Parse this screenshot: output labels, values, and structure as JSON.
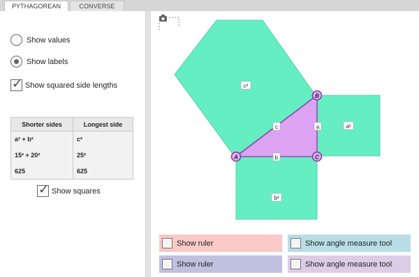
{
  "tabs": [
    {
      "label": "PYTHAGOREAN"
    },
    {
      "label": "CONVERSE"
    }
  ],
  "options": {
    "show_values": "Show values",
    "show_labels": "Show labels",
    "show_squared": "Show squared side lengths",
    "show_squares": "Show squares"
  },
  "table": {
    "headers": [
      "Shorter sides",
      "Longest side"
    ],
    "rows": [
      {
        "left": "a² + b²",
        "right": "c²"
      },
      {
        "left": "15² + 20²",
        "right": "25²"
      },
      {
        "left": "625",
        "right": "625"
      }
    ]
  },
  "geometry_labels": {
    "vertex_a": "A",
    "vertex_b": "B",
    "vertex_c": "C",
    "side_a": "a",
    "side_b": "b",
    "side_c": "c",
    "square_a": "a²",
    "square_b": "b²",
    "square_c": "c²"
  },
  "tools": {
    "ruler_top": "Show ruler",
    "angle_top": "Show angle measure tool",
    "ruler_bottom": "Show ruler",
    "angle_bottom": "Show angle measure tool"
  },
  "colors": {
    "square_fill": "#66eec3",
    "triangle_fill": "#dca3f2",
    "vertex_fill": "#e3aaf5",
    "vertex_stroke": "#7b3d9b",
    "ruler_top_bg": "#f8c9c6",
    "angle_top_bg": "#b9dde4",
    "ruler_bottom_bg": "#c0c0e0",
    "angle_bottom_bg": "#dccce6"
  },
  "icons": {
    "camera": "camera-icon",
    "check": "checkmark-icon"
  }
}
